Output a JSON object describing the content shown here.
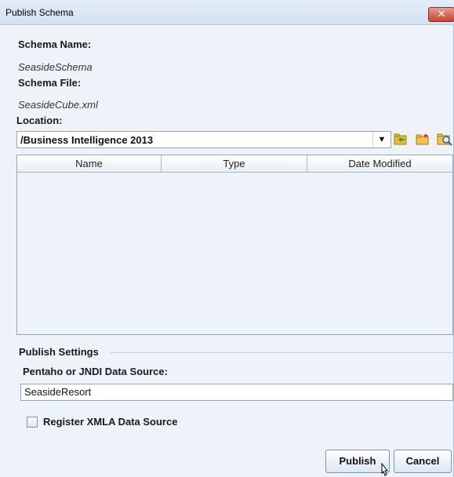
{
  "window": {
    "title": "Publish Schema",
    "close_glyph": "✕"
  },
  "schema": {
    "name_label": "Schema Name:",
    "name_value": "SeasideSchema",
    "file_label": "Schema File:",
    "file_value": "SeasideCube.xml"
  },
  "location": {
    "label": "Location:",
    "value": "/Business Intelligence 2013",
    "arrow_glyph": "▼",
    "tools": [
      "refresh-folder-icon",
      "new-folder-icon",
      "browse-folder-icon"
    ]
  },
  "table": {
    "columns": [
      "Name",
      "Type",
      "Date Modified"
    ],
    "rows": []
  },
  "publish_settings": {
    "group_title": "Publish Settings",
    "datasource_label": "Pentaho or JNDI Data Source:",
    "datasource_value": "SeasideResort",
    "register_xmla_label": "Register XMLA Data Source",
    "register_xmla_checked": false
  },
  "buttons": {
    "publish": "Publish",
    "cancel": "Cancel"
  }
}
